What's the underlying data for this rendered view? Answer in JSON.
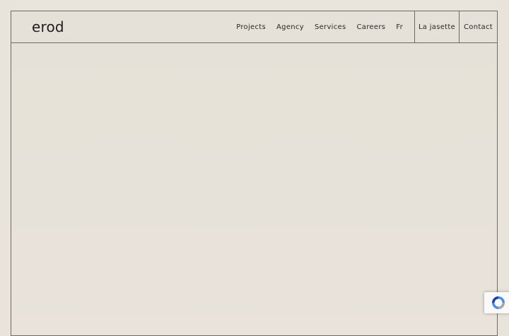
{
  "brand": {
    "logo_text": "erod"
  },
  "nav": {
    "items": [
      {
        "label": "Projects"
      },
      {
        "label": "Agency"
      },
      {
        "label": "Services"
      },
      {
        "label": "Careers"
      },
      {
        "label": "Fr"
      }
    ],
    "la_jasette": "La jasette",
    "contact": "Contact"
  },
  "colors": {
    "background": "#e7e2d9",
    "line": "#6e6a63",
    "text": "#1f1d1a",
    "recaptcha_blue": "#4a90e2"
  },
  "icons": {
    "recaptcha": "recaptcha-icon"
  }
}
